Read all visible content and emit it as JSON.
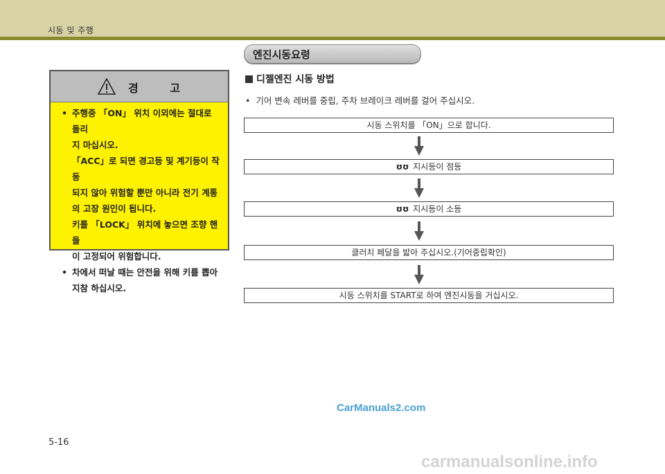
{
  "header": {
    "title": "시동 및 주행"
  },
  "section": {
    "title": "엔진시동요령"
  },
  "warning": {
    "title": "경 고",
    "items": [
      {
        "lines": [
          "주행중 「ON」 위치 이외에는 절대로 돌리",
          "지 마십시오.",
          "「ACC」로 되면 경고등 및 계기등이 작동",
          "되지 않아 위험할 뿐만 아니라 전기 계통",
          "의 고장 원인이 됩니다.",
          "키를 「LOCK」 위치에 놓으면 조향 핸들",
          "이 고정되어 위험합니다."
        ]
      },
      {
        "lines": [
          "차에서 떠날 때는 안전을 위해 키를 뽑아",
          "지참 하십시오."
        ]
      }
    ]
  },
  "diesel": {
    "heading": "디젤엔진 시동 방법",
    "bullet": "기어 변속 레버를 중립, 주차 브레이크 레버를 걸어 주십시오."
  },
  "steps": [
    {
      "text": "시동 스위치를 「ON」으로 합니다.",
      "icon": ""
    },
    {
      "text": "지시등이 점등",
      "icon": "glow-plug-icon"
    },
    {
      "text": "지시등이 소등",
      "icon": "glow-plug-icon"
    },
    {
      "text": "클러치 페달을 밟아 주십시오.(기어중립확인)",
      "icon": ""
    },
    {
      "text": "시동 스위치를 START로 하여 엔진시동을 거십시오.",
      "icon": ""
    }
  ],
  "glow_glyph": "ʊʊ",
  "page_number": "5-16",
  "watermark": "CarManuals2.com",
  "footer_watermark": "carmanualsonline.info",
  "colors": {
    "warning_bg": "#fff200",
    "header_band": "#d8d3a4",
    "header_line": "#8a8a2e"
  }
}
